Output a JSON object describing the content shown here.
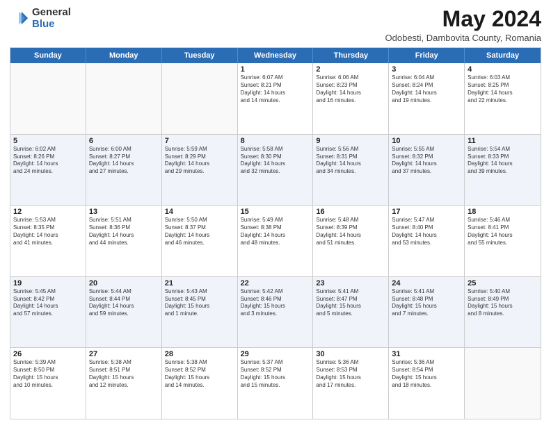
{
  "header": {
    "logo_general": "General",
    "logo_blue": "Blue",
    "main_title": "May 2024",
    "sub_title": "Odobesti, Dambovita County, Romania"
  },
  "calendar": {
    "days_of_week": [
      "Sunday",
      "Monday",
      "Tuesday",
      "Wednesday",
      "Thursday",
      "Friday",
      "Saturday"
    ],
    "rows": [
      [
        {
          "day": "",
          "info": ""
        },
        {
          "day": "",
          "info": ""
        },
        {
          "day": "",
          "info": ""
        },
        {
          "day": "1",
          "info": "Sunrise: 6:07 AM\nSunset: 8:21 PM\nDaylight: 14 hours\nand 14 minutes."
        },
        {
          "day": "2",
          "info": "Sunrise: 6:06 AM\nSunset: 8:23 PM\nDaylight: 14 hours\nand 16 minutes."
        },
        {
          "day": "3",
          "info": "Sunrise: 6:04 AM\nSunset: 8:24 PM\nDaylight: 14 hours\nand 19 minutes."
        },
        {
          "day": "4",
          "info": "Sunrise: 6:03 AM\nSunset: 8:25 PM\nDaylight: 14 hours\nand 22 minutes."
        }
      ],
      [
        {
          "day": "5",
          "info": "Sunrise: 6:02 AM\nSunset: 8:26 PM\nDaylight: 14 hours\nand 24 minutes."
        },
        {
          "day": "6",
          "info": "Sunrise: 6:00 AM\nSunset: 8:27 PM\nDaylight: 14 hours\nand 27 minutes."
        },
        {
          "day": "7",
          "info": "Sunrise: 5:59 AM\nSunset: 8:29 PM\nDaylight: 14 hours\nand 29 minutes."
        },
        {
          "day": "8",
          "info": "Sunrise: 5:58 AM\nSunset: 8:30 PM\nDaylight: 14 hours\nand 32 minutes."
        },
        {
          "day": "9",
          "info": "Sunrise: 5:56 AM\nSunset: 8:31 PM\nDaylight: 14 hours\nand 34 minutes."
        },
        {
          "day": "10",
          "info": "Sunrise: 5:55 AM\nSunset: 8:32 PM\nDaylight: 14 hours\nand 37 minutes."
        },
        {
          "day": "11",
          "info": "Sunrise: 5:54 AM\nSunset: 8:33 PM\nDaylight: 14 hours\nand 39 minutes."
        }
      ],
      [
        {
          "day": "12",
          "info": "Sunrise: 5:53 AM\nSunset: 8:35 PM\nDaylight: 14 hours\nand 41 minutes."
        },
        {
          "day": "13",
          "info": "Sunrise: 5:51 AM\nSunset: 8:36 PM\nDaylight: 14 hours\nand 44 minutes."
        },
        {
          "day": "14",
          "info": "Sunrise: 5:50 AM\nSunset: 8:37 PM\nDaylight: 14 hours\nand 46 minutes."
        },
        {
          "day": "15",
          "info": "Sunrise: 5:49 AM\nSunset: 8:38 PM\nDaylight: 14 hours\nand 48 minutes."
        },
        {
          "day": "16",
          "info": "Sunrise: 5:48 AM\nSunset: 8:39 PM\nDaylight: 14 hours\nand 51 minutes."
        },
        {
          "day": "17",
          "info": "Sunrise: 5:47 AM\nSunset: 8:40 PM\nDaylight: 14 hours\nand 53 minutes."
        },
        {
          "day": "18",
          "info": "Sunrise: 5:46 AM\nSunset: 8:41 PM\nDaylight: 14 hours\nand 55 minutes."
        }
      ],
      [
        {
          "day": "19",
          "info": "Sunrise: 5:45 AM\nSunset: 8:42 PM\nDaylight: 14 hours\nand 57 minutes."
        },
        {
          "day": "20",
          "info": "Sunrise: 5:44 AM\nSunset: 8:44 PM\nDaylight: 14 hours\nand 59 minutes."
        },
        {
          "day": "21",
          "info": "Sunrise: 5:43 AM\nSunset: 8:45 PM\nDaylight: 15 hours\nand 1 minute."
        },
        {
          "day": "22",
          "info": "Sunrise: 5:42 AM\nSunset: 8:46 PM\nDaylight: 15 hours\nand 3 minutes."
        },
        {
          "day": "23",
          "info": "Sunrise: 5:41 AM\nSunset: 8:47 PM\nDaylight: 15 hours\nand 5 minutes."
        },
        {
          "day": "24",
          "info": "Sunrise: 5:41 AM\nSunset: 8:48 PM\nDaylight: 15 hours\nand 7 minutes."
        },
        {
          "day": "25",
          "info": "Sunrise: 5:40 AM\nSunset: 8:49 PM\nDaylight: 15 hours\nand 8 minutes."
        }
      ],
      [
        {
          "day": "26",
          "info": "Sunrise: 5:39 AM\nSunset: 8:50 PM\nDaylight: 15 hours\nand 10 minutes."
        },
        {
          "day": "27",
          "info": "Sunrise: 5:38 AM\nSunset: 8:51 PM\nDaylight: 15 hours\nand 12 minutes."
        },
        {
          "day": "28",
          "info": "Sunrise: 5:38 AM\nSunset: 8:52 PM\nDaylight: 15 hours\nand 14 minutes."
        },
        {
          "day": "29",
          "info": "Sunrise: 5:37 AM\nSunset: 8:52 PM\nDaylight: 15 hours\nand 15 minutes."
        },
        {
          "day": "30",
          "info": "Sunrise: 5:36 AM\nSunset: 8:53 PM\nDaylight: 15 hours\nand 17 minutes."
        },
        {
          "day": "31",
          "info": "Sunrise: 5:36 AM\nSunset: 8:54 PM\nDaylight: 15 hours\nand 18 minutes."
        },
        {
          "day": "",
          "info": ""
        }
      ]
    ]
  }
}
